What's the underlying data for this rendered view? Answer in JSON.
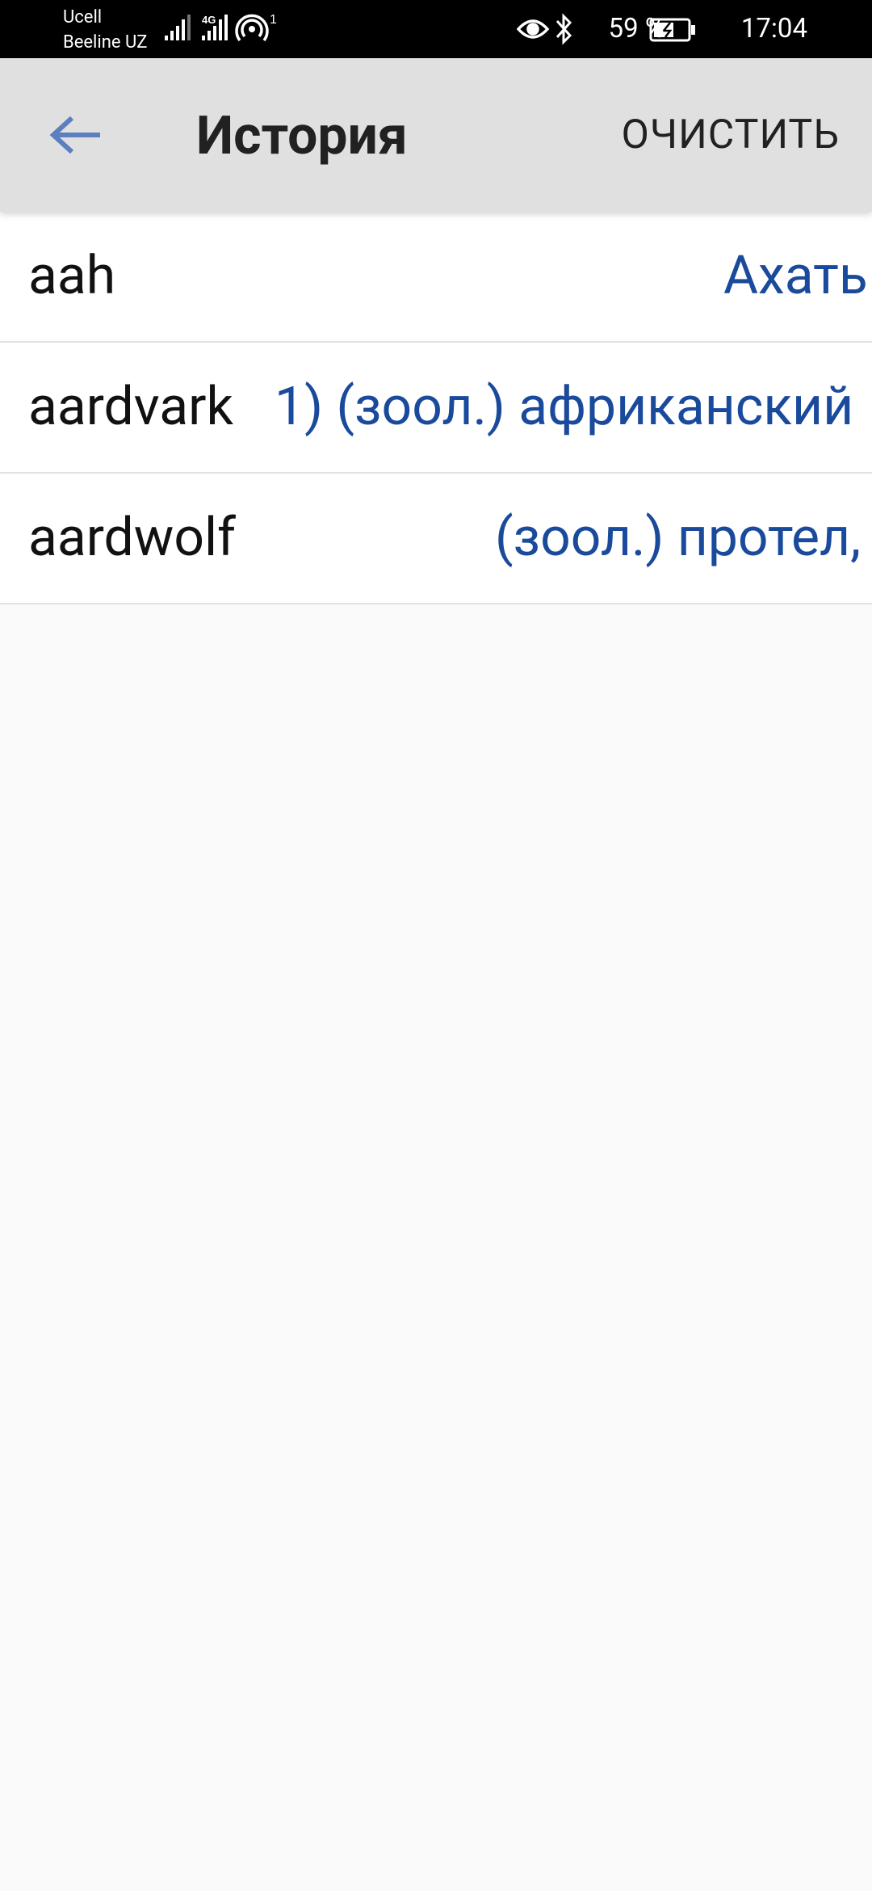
{
  "status_bar": {
    "carrier_1": "Ucell",
    "carrier_2": "Beeline UZ",
    "network_type": "4G",
    "hotspot_count": "1",
    "battery_percent": "59 %",
    "time": "17:04"
  },
  "app_bar": {
    "title": "История",
    "clear_label": "ОЧИСТИТЬ",
    "back_icon": "arrow-back-icon"
  },
  "history": [
    {
      "word": "aah",
      "translation": "Ахать"
    },
    {
      "word": "aardvark",
      "translation": "1) (зоол.) африканский"
    },
    {
      "word": "aardwolf",
      "translation": "(зоол.) протел,"
    }
  ],
  "colors": {
    "status_bar_bg": "#000000",
    "app_bar_bg": "#e0e0e0",
    "translation_text": "#1a4a9c",
    "back_arrow": "#5b7fbf",
    "background": "#fafafa"
  }
}
